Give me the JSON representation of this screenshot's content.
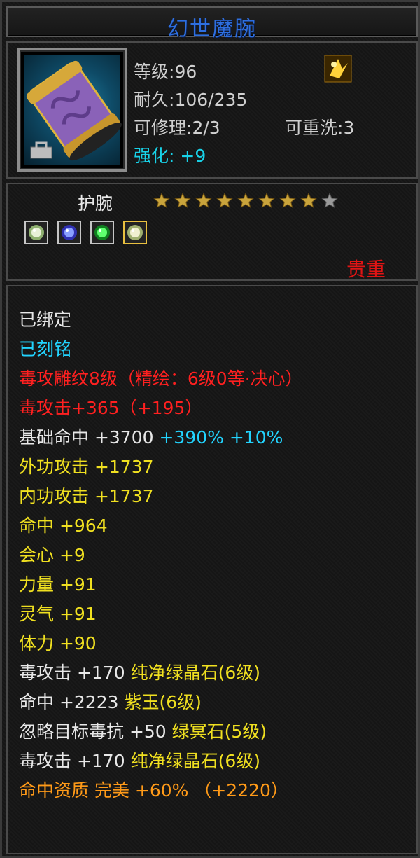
{
  "title": "幻世魔腕",
  "item": {
    "icon": "purple-gold-wristguard-icon",
    "level_label": "等级",
    "level": "96",
    "durability_label": "耐久",
    "durability": "106/235",
    "repair_label": "可修理",
    "repair": "2/3",
    "rewash_label": "可重洗",
    "rewash": "3",
    "refine_label": "强化:",
    "refine": "+9"
  },
  "subinfo": {
    "type": "护腕",
    "stars_total": 9,
    "stars_filled": 8,
    "gems": [
      "pale-gem-icon",
      "blue-gem-icon",
      "green-gem-icon",
      "pale-gem-gold-icon"
    ],
    "rarity": "贵重"
  },
  "attributes": [
    {
      "parts": [
        {
          "t": "已绑定",
          "c": "white"
        }
      ]
    },
    {
      "parts": [
        {
          "t": "已刻铭",
          "c": "cyan2"
        }
      ]
    },
    {
      "parts": [
        {
          "t": "毒攻雕纹8级（精绘：6级0等·决心）",
          "c": "red"
        }
      ]
    },
    {
      "parts": [
        {
          "t": "毒攻击+365（+195）",
          "c": "red"
        }
      ]
    },
    {
      "parts": [
        {
          "t": "基础命中 +3700 ",
          "c": "white"
        },
        {
          "t": "+390% +10%",
          "c": "cyan2"
        }
      ]
    },
    {
      "parts": [
        {
          "t": "外功攻击 +1737",
          "c": "yellow"
        }
      ]
    },
    {
      "parts": [
        {
          "t": "内功攻击 +1737",
          "c": "yellow"
        }
      ]
    },
    {
      "parts": [
        {
          "t": "命中 +964",
          "c": "yellow"
        }
      ]
    },
    {
      "parts": [
        {
          "t": "会心 +9",
          "c": "yellow"
        }
      ]
    },
    {
      "parts": [
        {
          "t": "力量 +91",
          "c": "yellow"
        }
      ]
    },
    {
      "parts": [
        {
          "t": "灵气 +91",
          "c": "yellow"
        }
      ]
    },
    {
      "parts": [
        {
          "t": "体力 +90",
          "c": "yellow"
        }
      ]
    },
    {
      "parts": [
        {
          "t": "毒攻击 +170 ",
          "c": "white"
        },
        {
          "t": "纯净绿晶石(6级)",
          "c": "yellow"
        }
      ]
    },
    {
      "parts": [
        {
          "t": "命中 +2223 ",
          "c": "white"
        },
        {
          "t": "紫玉(6级)",
          "c": "yellow"
        }
      ]
    },
    {
      "parts": [
        {
          "t": "忽略目标毒抗 +50 ",
          "c": "white"
        },
        {
          "t": "绿冥石(5级)",
          "c": "yellow"
        }
      ]
    },
    {
      "parts": [
        {
          "t": "毒攻击 +170 ",
          "c": "white"
        },
        {
          "t": "纯净绿晶石(6级)",
          "c": "yellow"
        }
      ]
    },
    {
      "parts": [
        {
          "t": "命中资质  完美 +60% （+2220）",
          "c": "orange"
        }
      ]
    }
  ]
}
